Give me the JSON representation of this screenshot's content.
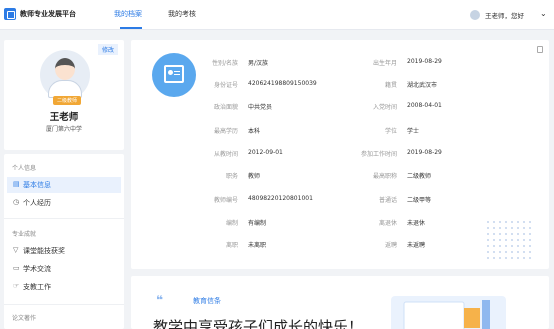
{
  "app": {
    "title": "教师专业发展平台"
  },
  "nav": {
    "tabs": [
      {
        "label": "我的档案",
        "active": true
      },
      {
        "label": "我的考核",
        "active": false
      }
    ]
  },
  "user": {
    "greeting": "王老师，您好"
  },
  "profile": {
    "edit_label": "修改",
    "level_badge": "二级教师",
    "name": "王老师",
    "school": "厦门第六中学"
  },
  "menu": {
    "sections": [
      {
        "title": "个人信息",
        "items": [
          {
            "label": "基本信息",
            "icon": "doc-icon",
            "active": true
          },
          {
            "label": "个人经历",
            "icon": "clock-icon",
            "active": false
          }
        ]
      },
      {
        "title": "专业成就",
        "items": [
          {
            "label": "课堂能技获奖",
            "icon": "funnel-icon",
            "active": false
          },
          {
            "label": "学术交流",
            "icon": "chat-icon",
            "active": false
          },
          {
            "label": "支教工作",
            "icon": "hand-icon",
            "active": false
          }
        ]
      },
      {
        "title": "论文著作",
        "items": []
      }
    ]
  },
  "info": {
    "left": [
      {
        "label": "性别/名族",
        "value": "男/汉族"
      },
      {
        "label": "身份证号",
        "value": "420624198809150039"
      },
      {
        "label": "政治面貌",
        "value": "中共党员"
      },
      {
        "label": "最高学历",
        "value": "本科"
      },
      {
        "label": "从教时间",
        "value": "2012-09-01"
      },
      {
        "label": "职务",
        "value": "教师"
      },
      {
        "label": "教师编号",
        "value": "4809822012080100​1"
      },
      {
        "label": "编制",
        "value": "有编制"
      },
      {
        "label": "离职",
        "value": "未离职"
      }
    ],
    "right": [
      {
        "label": "出生年月",
        "value": "2019-08-29"
      },
      {
        "label": "籍贯",
        "value": "湖北武汉市"
      },
      {
        "label": "入党时间",
        "value": "2008-04-01"
      },
      {
        "label": "学位",
        "value": "学士"
      },
      {
        "label": "参加工作时间",
        "value": "2019-08-29"
      },
      {
        "label": "最高职称",
        "value": "二级教师"
      },
      {
        "label": "普通话",
        "value": "二级甲等"
      },
      {
        "label": "离退休",
        "value": "未退休"
      },
      {
        "label": "返聘",
        "value": "未返聘"
      }
    ]
  },
  "motto": {
    "tag": "教育信条",
    "text": "教学中享受孩子们成长的快乐！"
  },
  "colors": {
    "accent": "#2c7be5",
    "badge": "#f1a735",
    "id_circle": "#5aa8ee"
  }
}
